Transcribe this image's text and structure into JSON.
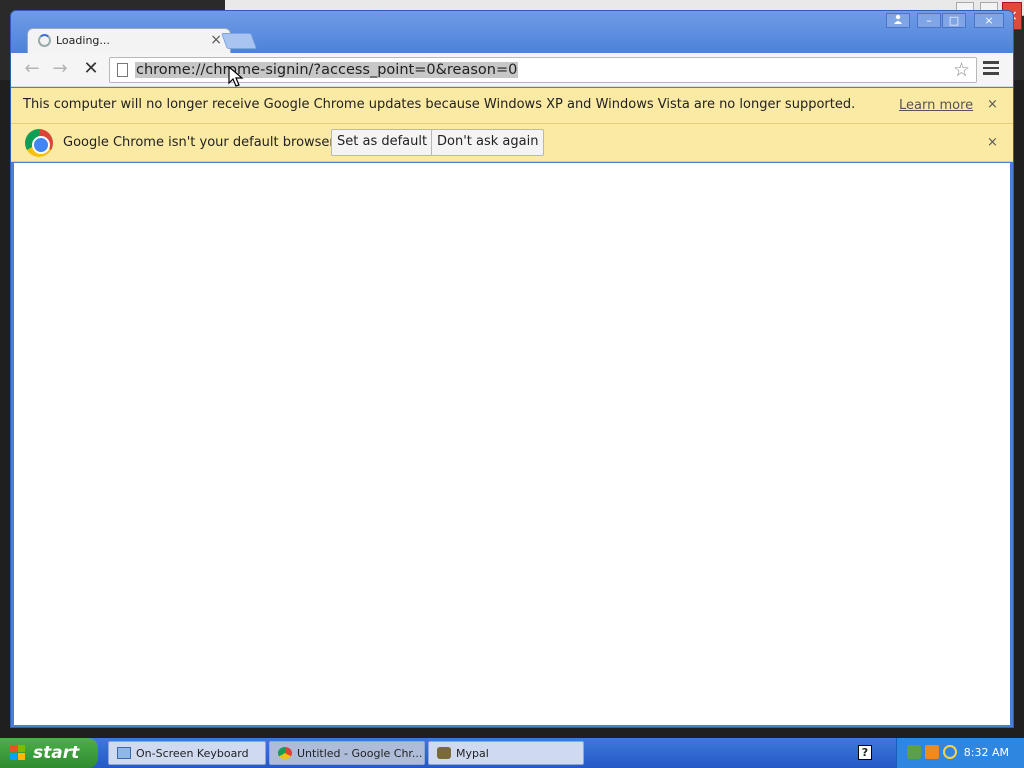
{
  "browser": {
    "tab": {
      "title": "Loading...",
      "close_glyph": "×"
    },
    "window_buttons": {
      "user": "user-icon",
      "minimize": "–",
      "maximize": "□",
      "close": "×"
    },
    "nav": {
      "back": "←",
      "forward": "→",
      "stop": "✕"
    },
    "omnibox": {
      "url": "chrome://chrome-signin/?access_point=0&reason=0"
    },
    "star_glyph": "☆"
  },
  "infobars": {
    "update": {
      "text": "This computer will no longer receive Google Chrome updates because Windows XP and Windows Vista are no longer supported.",
      "link": "Learn more",
      "close_glyph": "×"
    },
    "default_browser": {
      "text": "Google Chrome isn't your default browser.",
      "set_default": "Set as default",
      "dont_ask": "Don't ask again",
      "close_glyph": "×"
    }
  },
  "taskbar": {
    "start_label": "start",
    "items": [
      {
        "label": "On-Screen Keyboard",
        "icon": "keyboard-icon"
      },
      {
        "label": "Untitled - Google Chr...",
        "icon": "chrome-icon",
        "active": true
      },
      {
        "label": "Mypal",
        "icon": "mypal-icon"
      }
    ],
    "help_glyph": "?",
    "clock": "8:32 AM"
  }
}
